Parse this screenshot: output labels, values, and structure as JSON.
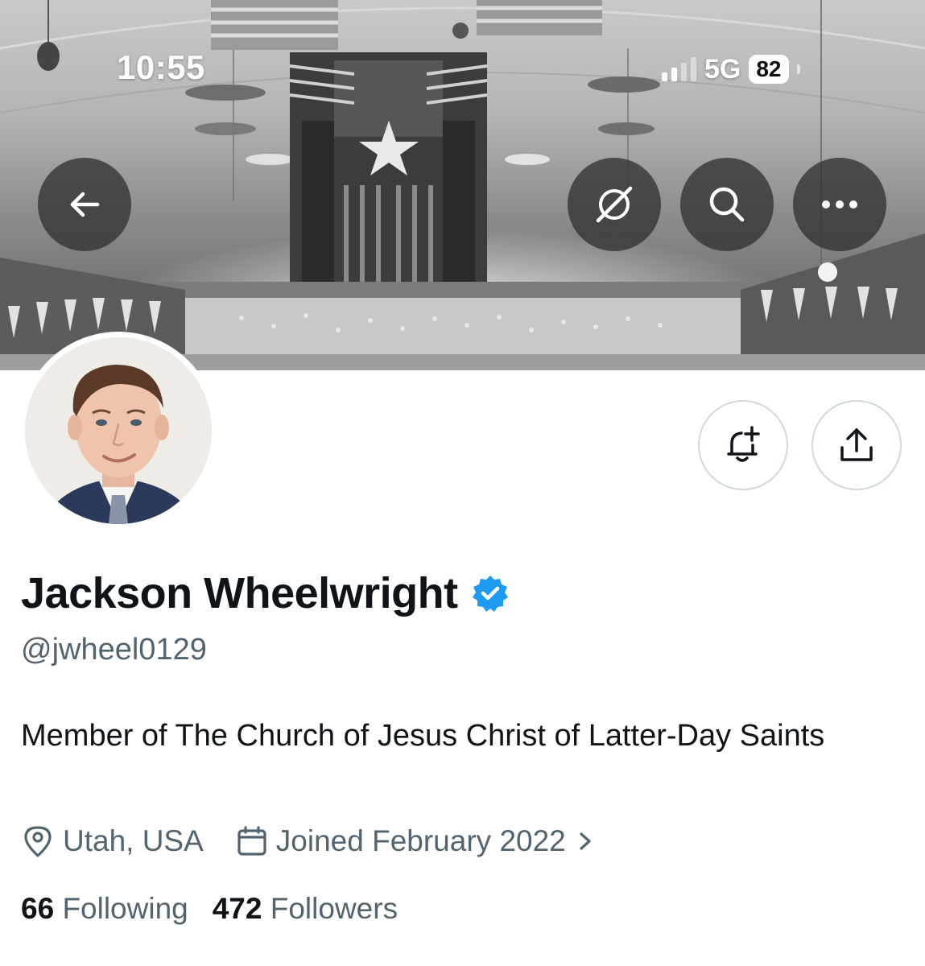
{
  "status_bar": {
    "time": "10:55",
    "network": "5G",
    "battery": "82"
  },
  "header_buttons": {
    "back_icon": "arrow-left-icon",
    "grok_icon": "grok-icon",
    "search_icon": "search-icon",
    "more_icon": "more-icon"
  },
  "profile": {
    "display_name": "Jackson Wheelwright",
    "verified": true,
    "handle": "@jwheel0129",
    "bio": "Member of The Church of Jesus Christ of Latter-Day Saints",
    "location": "Utah, USA",
    "joined": "Joined February 2022",
    "following_count": "66",
    "following_label": "Following",
    "followers_count": "472",
    "followers_label": "Followers"
  },
  "actions": {
    "notify_icon": "bell-plus-icon",
    "share_icon": "share-icon"
  },
  "colors": {
    "verified_badge": "#1d9bf0",
    "text_primary": "#0f1419",
    "text_secondary": "#536471",
    "button_border": "#cfd9de"
  }
}
